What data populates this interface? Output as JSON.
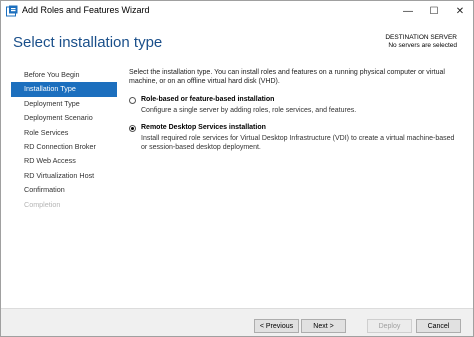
{
  "window": {
    "title": "Add Roles and Features Wizard",
    "controls": {
      "minimize": "—",
      "maximize": "☐",
      "close": "✕"
    }
  },
  "header": {
    "page_title": "Select installation type",
    "destination_label": "DESTINATION SERVER",
    "destination_value": "No servers are selected"
  },
  "nav": {
    "items": [
      {
        "label": "Before You Begin",
        "state": "normal"
      },
      {
        "label": "Installation Type",
        "state": "active"
      },
      {
        "label": "Deployment Type",
        "state": "normal"
      },
      {
        "label": "Deployment Scenario",
        "state": "normal"
      },
      {
        "label": "Role Services",
        "state": "normal"
      },
      {
        "label": "RD Connection Broker",
        "state": "normal"
      },
      {
        "label": "RD Web Access",
        "state": "normal"
      },
      {
        "label": "RD Virtualization Host",
        "state": "normal"
      },
      {
        "label": "Confirmation",
        "state": "normal"
      },
      {
        "label": "Completion",
        "state": "disabled"
      }
    ]
  },
  "main": {
    "intro": "Select the installation type. You can install roles and features on a running physical computer or virtual machine, or on an offline virtual hard disk (VHD).",
    "options": [
      {
        "title": "Role-based or feature-based installation",
        "description": "Configure a single server by adding roles, role services, and features.",
        "selected": false
      },
      {
        "title": "Remote Desktop Services installation",
        "description": "Install required role services for Virtual Desktop Infrastructure (VDI) to create a virtual machine-based or session-based desktop deployment.",
        "selected": true
      }
    ]
  },
  "footer": {
    "previous": "< Previous",
    "next": "Next >",
    "deploy": "Deploy",
    "cancel": "Cancel"
  },
  "colors": {
    "accent": "#1c6fbe",
    "title": "#1a4f8a",
    "disabled_text": "#b5b5b5"
  }
}
